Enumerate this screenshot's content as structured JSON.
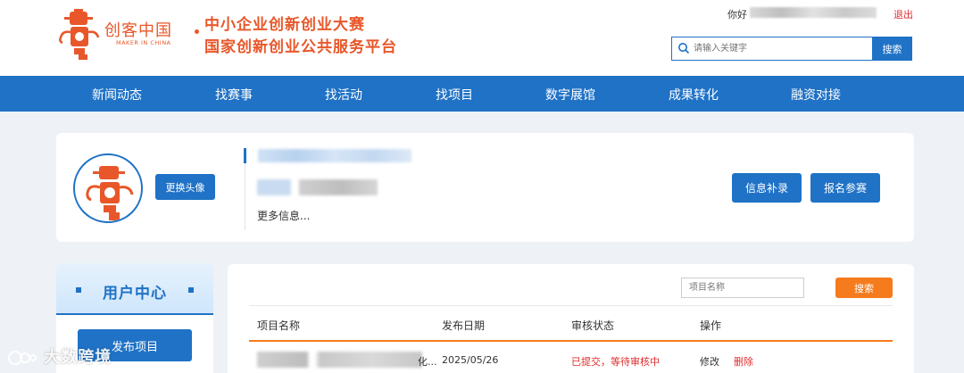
{
  "header": {
    "logo_cn": "创客中国",
    "logo_en": "MAKER IN CHINA",
    "slogan_line1": "中小企业创新创业大赛",
    "slogan_line2": "国家创新创业公共服务平台",
    "greeting": "你好",
    "logout": "退出",
    "search_placeholder": "请输入关键字",
    "search_button": "搜索"
  },
  "nav": {
    "items": [
      "新闻动态",
      "找赛事",
      "找活动",
      "找项目",
      "数字展馆",
      "成果转化",
      "融资对接"
    ]
  },
  "profile": {
    "change_avatar": "更换头像",
    "more_info": "更多信息...",
    "supplement_button": "信息补录",
    "register_button": "报名参赛"
  },
  "sidebar": {
    "title": "用户中心",
    "publish_button": "发布项目"
  },
  "projects": {
    "name_placeholder": "项目名称",
    "search_button": "搜索",
    "columns": [
      "项目名称",
      "发布日期",
      "审核状态",
      "操作"
    ],
    "rows": [
      {
        "name_suffix": "化...",
        "date": "2025/05/26",
        "status": "已提交，等待审核中",
        "edit": "修改",
        "delete": "删除"
      }
    ]
  },
  "colors": {
    "brand_blue": "#1f72c6",
    "brand_orange": "#e8572a",
    "action_orange": "#f57b1d",
    "danger_red": "#e02d2d"
  },
  "watermark": "大数跨境"
}
